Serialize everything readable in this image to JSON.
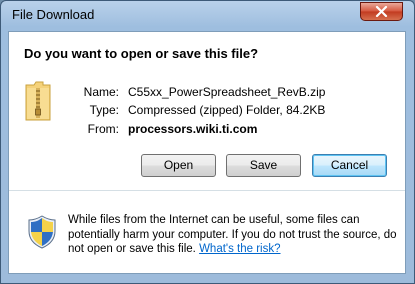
{
  "window": {
    "title": "File Download"
  },
  "dialog": {
    "question": "Do you want to open or save this file?",
    "fields": [
      {
        "label": "Name:",
        "value": "C55xx_PowerSpreadsheet_RevB.zip"
      },
      {
        "label": "Type:",
        "value": "Compressed (zipped) Folder, 84.2KB"
      },
      {
        "label": "From:",
        "value": "processors.wiki.ti.com"
      }
    ],
    "buttons": {
      "open": "Open",
      "save": "Save",
      "cancel": "Cancel"
    },
    "warning": {
      "text": "While files from the Internet can be useful, some files can potentially harm your computer. If you do not trust the source, do not open or save this file.",
      "link": "What's the risk?"
    }
  },
  "icons": {
    "file": "zip-folder-icon",
    "security": "shield-icon",
    "close": "close-icon"
  }
}
